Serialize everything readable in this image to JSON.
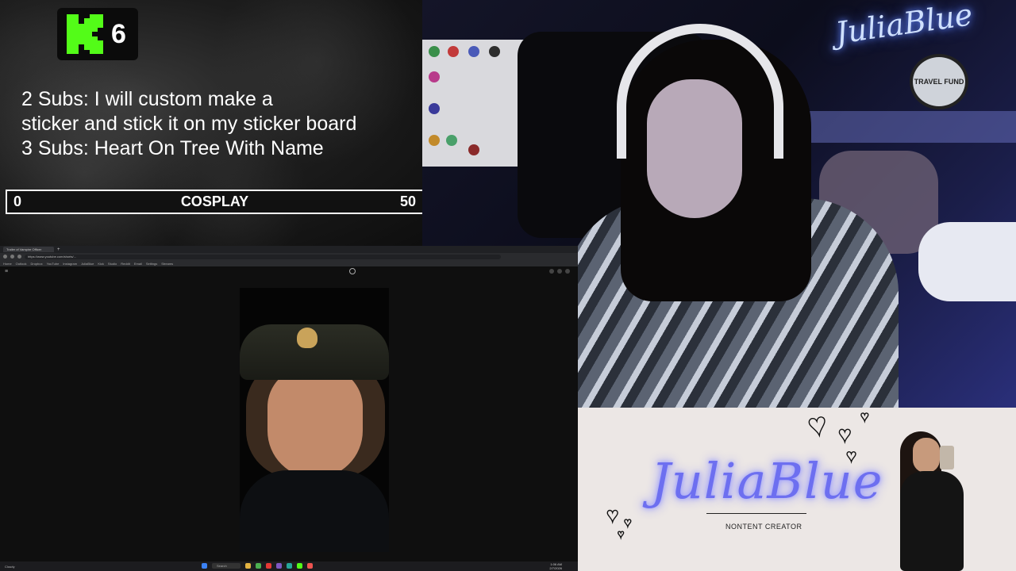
{
  "goal_panel": {
    "kick_count": "6",
    "lines": [
      "2 Subs: I will custom make a",
      "sticker and stick it on my sticker board",
      "3 Subs: Heart On Tree With Name"
    ],
    "bar": {
      "min": "0",
      "label": "COSPLAY",
      "max": "50",
      "progress": 0
    }
  },
  "webcam": {
    "neon_sign": "JuliaBlue",
    "travel_fund": "TRAVEL FUND"
  },
  "browser": {
    "tab_title": "Trailer of Vampire Officer",
    "url": "https://www.youtube.com/shorts/...",
    "bookmarks": [
      "Home",
      "Outlook",
      "Dropbox",
      "YouTube",
      "Instagram",
      "JuliaBlue",
      "Kick",
      "Studio",
      "Reddit",
      "Email",
      "Settings",
      "Streams"
    ],
    "taskbar_search": "Search",
    "weather": "Cloudy",
    "clock_time": "1:06 AM",
    "clock_date": "2/7/2026"
  },
  "brand": {
    "name": "JuliaBlue",
    "tagline": "NONTENT CREATOR"
  },
  "colors": {
    "kick_green": "#53fc18",
    "brand_purple": "#6d6ff0"
  }
}
